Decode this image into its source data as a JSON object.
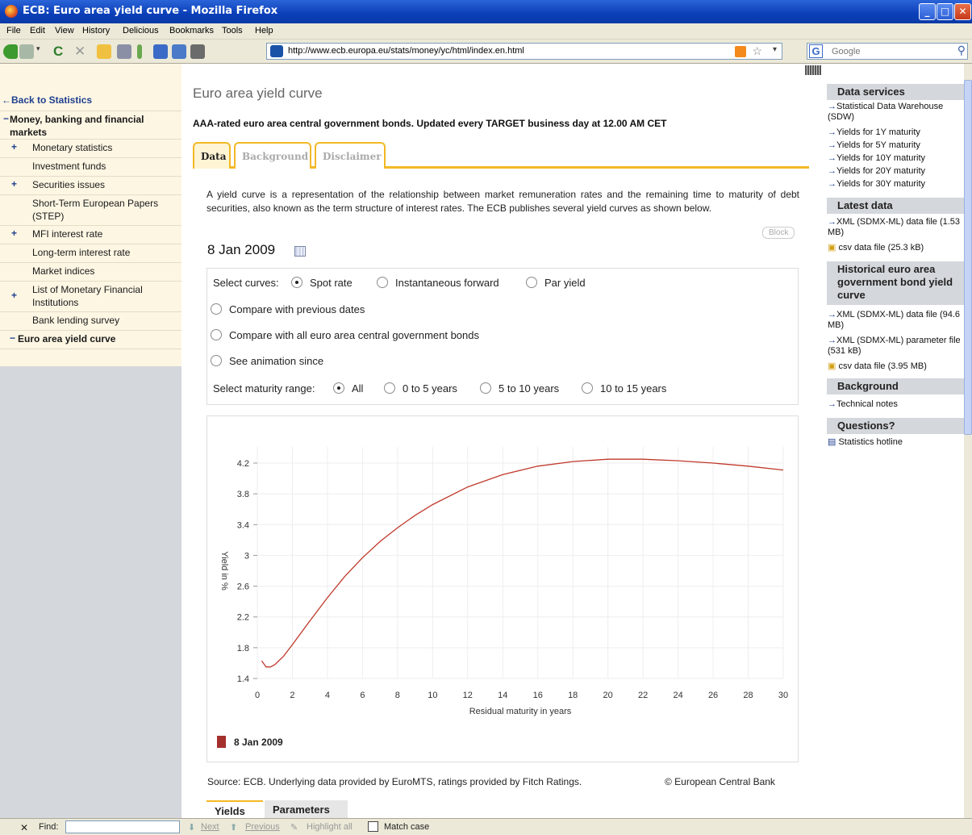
{
  "window": {
    "title": "ECB: Euro area yield curve - Mozilla Firefox"
  },
  "menu": [
    "File",
    "Edit",
    "View",
    "History",
    "Delicious",
    "Bookmarks",
    "Tools",
    "Help"
  ],
  "address": {
    "url": "http://www.ecb.europa.eu/stats/money/yc/html/index.en.html"
  },
  "search": {
    "placeholder": "Google"
  },
  "leftnav": {
    "back": "←Back to Statistics",
    "section": "Money, banking and financial markets",
    "items": [
      {
        "label": "Monetary statistics",
        "plus": true
      },
      {
        "label": "Investment funds",
        "plus": false
      },
      {
        "label": "Securities issues",
        "plus": true
      },
      {
        "label": "Short-Term European Papers (STEP)",
        "plus": false
      },
      {
        "label": "MFI interest rate",
        "plus": true
      },
      {
        "label": "Long-term interest rate",
        "plus": false
      },
      {
        "label": "Market indices",
        "plus": false
      },
      {
        "label": "List of Monetary Financial Institutions",
        "plus": true
      },
      {
        "label": "Bank lending survey",
        "plus": false
      },
      {
        "label": "Euro area yield curve",
        "plus": false,
        "active": true
      }
    ]
  },
  "main": {
    "title": "Euro area yield curve",
    "subtitle": "AAA-rated euro area central government bonds. Updated every TARGET business day at 12.00 AM CET",
    "tabs": [
      "Data",
      "Background",
      "Disclaimer"
    ],
    "description": "A yield curve is a representation of the relationship between market remuneration rates and the remaining time to maturity of debt securities, also known as the term structure of interest rates. The ECB publishes several yield curves as shown below.",
    "block_label": "Block",
    "date": "8 Jan 2009",
    "select_curves_label": "Select curves:",
    "curves": [
      "Spot rate",
      "Instantaneous forward",
      "Par yield"
    ],
    "compare_prev": "Compare with previous dates",
    "compare_all": "Compare with all euro area central government bonds",
    "animation": "See animation since",
    "maturity_label": "Select maturity range:",
    "maturity": [
      "All",
      "0 to 5 years",
      "5 to 10 years",
      "10 to 15 years"
    ],
    "source": "Source: ECB. Underlying data provided by EuroMTS, ratings provided by Fitch Ratings.",
    "copyright": "© European Central Bank",
    "bottom_tabs": [
      "Yields",
      "Parameters"
    ]
  },
  "chart_data": {
    "type": "line",
    "xlabel": "Residual maturity in years",
    "ylabel": "Yield in %",
    "xlim": [
      0,
      30
    ],
    "ylim": [
      1.4,
      4.2
    ],
    "xticks": [
      0,
      2,
      4,
      6,
      8,
      10,
      12,
      14,
      16,
      18,
      20,
      22,
      24,
      26,
      28,
      30
    ],
    "yticks": [
      1.4,
      1.8,
      2.2,
      2.6,
      3,
      3.4,
      3.8,
      4.2
    ],
    "grid": true,
    "series": [
      {
        "name": "8 Jan 2009",
        "color": "#c0392b",
        "x": [
          0.25,
          0.5,
          0.75,
          1,
          1.5,
          2,
          3,
          4,
          5,
          6,
          7,
          8,
          9,
          10,
          12,
          14,
          16,
          18,
          20,
          22,
          24,
          26,
          28,
          30
        ],
        "y": [
          1.63,
          1.55,
          1.55,
          1.58,
          1.69,
          1.84,
          2.15,
          2.45,
          2.73,
          2.97,
          3.18,
          3.36,
          3.52,
          3.66,
          3.89,
          4.05,
          4.16,
          4.22,
          4.25,
          4.25,
          4.23,
          4.2,
          4.16,
          4.11
        ]
      }
    ]
  },
  "right": {
    "data_services": "Data services",
    "ds_links": [
      "Statistical Data Warehouse (SDW)",
      "Yields for 1Y maturity",
      "Yields for 5Y maturity",
      "Yields for 10Y maturity",
      "Yields for 20Y maturity",
      "Yields for 30Y maturity"
    ],
    "latest": "Latest data",
    "latest_links": [
      "XML (SDMX-ML) data file (1.53 MB)",
      "csv data file (25.3 kB)"
    ],
    "historical": "Historical euro area government bond yield curve",
    "hist_links": [
      "XML (SDMX-ML) data file (94.6 MB)",
      "XML (SDMX-ML) parameter file (531 kB)",
      "csv data file (3.95 MB)"
    ],
    "background": "Background",
    "bg_links": [
      "Technical notes"
    ],
    "questions": "Questions?",
    "q_links": [
      "Statistics hotline"
    ]
  },
  "findbar": {
    "label": "Find:",
    "next": "Next",
    "previous": "Previous",
    "highlight": "Highlight all",
    "match": "Match case"
  }
}
